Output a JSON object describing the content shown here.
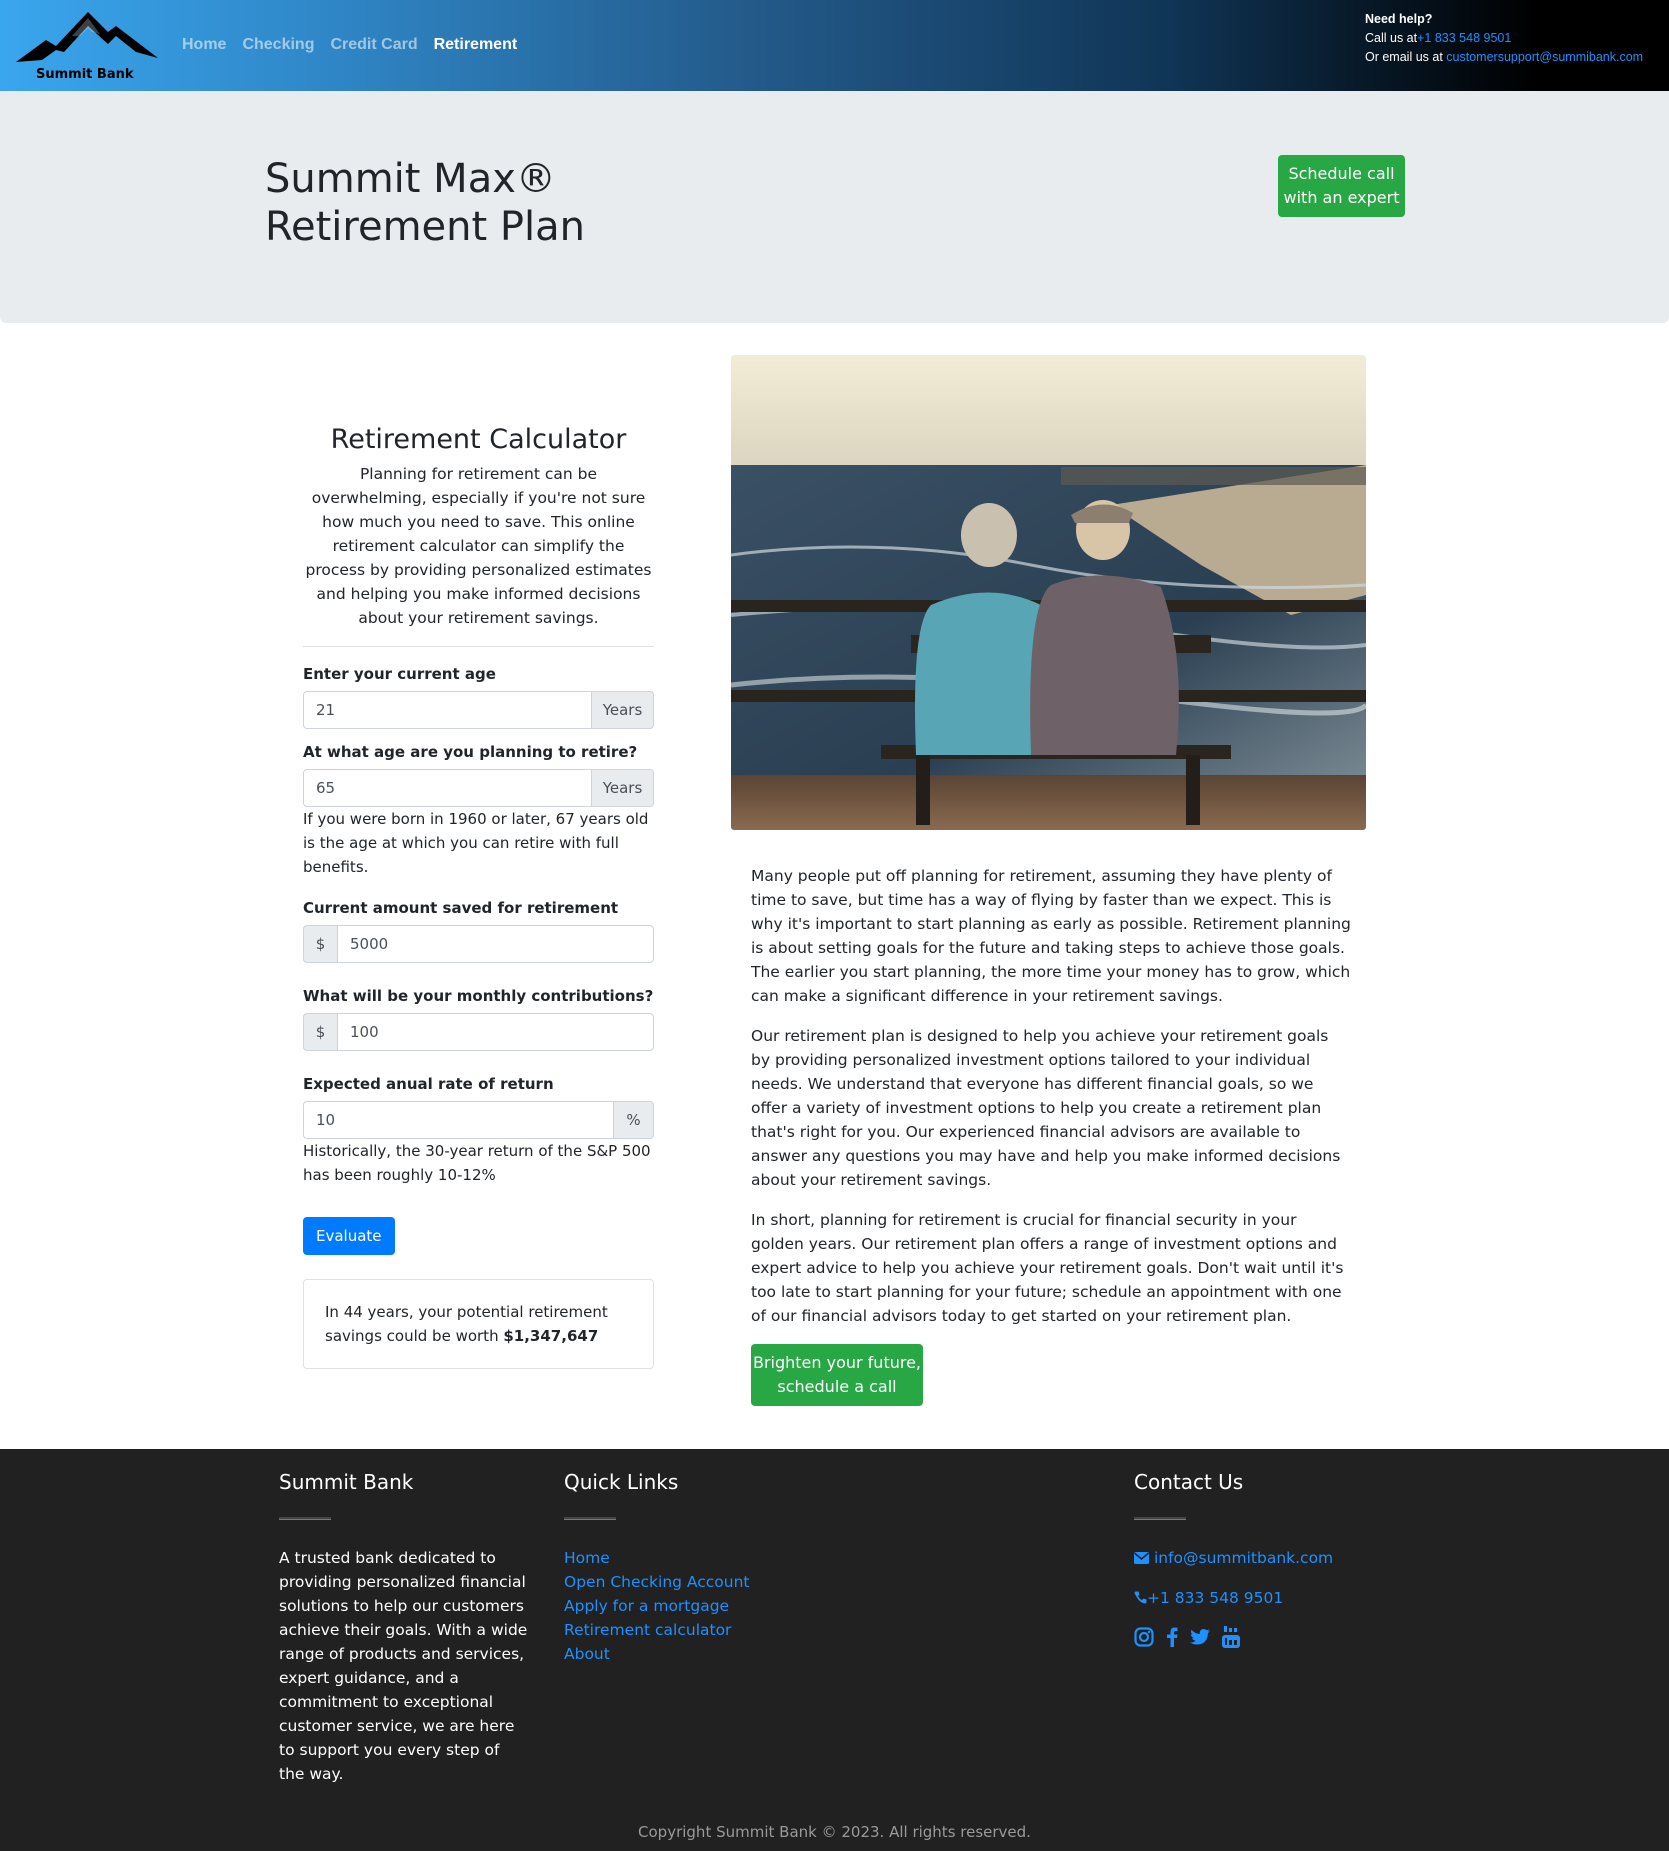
{
  "brand": {
    "name": "Summit Bank"
  },
  "nav": {
    "items": [
      {
        "label": "Home",
        "active": false
      },
      {
        "label": "Checking",
        "active": false
      },
      {
        "label": "Credit Card",
        "active": false
      },
      {
        "label": "Retirement",
        "active": true
      }
    ]
  },
  "help": {
    "title": "Need help?",
    "call_prefix": "Call us at",
    "phone": "+1 833 548 9501",
    "email_prefix": "Or email us at",
    "email": "customersupport@summibank.com"
  },
  "hero": {
    "title_line1": "Summit Max®",
    "title_line2": "Retirement Plan",
    "button_line1": "Schedule call",
    "button_line2": "with an expert"
  },
  "calculator": {
    "title": "Retirement Calculator",
    "intro": "Planning for retirement can be overwhelming, especially if you're not sure how much you need to save. This online retirement calculator can simplify the process by providing personalized estimates and helping you make informed decisions about your retirement savings.",
    "fields": {
      "current_age": {
        "label": "Enter your current age",
        "value": "21",
        "addon": "Years"
      },
      "retire_age": {
        "label": "At what age are you planning to retire?",
        "value": "65",
        "addon": "Years",
        "help": "If you were born in 1960 or later, 67 years old is the age at which you can retire with full benefits."
      },
      "current_saved": {
        "label": "Current amount saved for retirement",
        "value": "5000",
        "addon": "$"
      },
      "monthly": {
        "label": "What will be your monthly contributions?",
        "value": "100",
        "addon": "$"
      },
      "rate": {
        "label": "Expected anual rate of return",
        "value": "10",
        "addon": "%",
        "help": "Historically, the 30-year return of the S&P 500 has been roughly 10-12%"
      }
    },
    "button": "Evaluate",
    "result_prefix": "In 44 years, your potential retirement savings could be worth",
    "result_value": "$1,347,647"
  },
  "article": {
    "p1": "Many people put off planning for retirement, assuming they have plenty of time to save, but time has a way of flying by faster than we expect. This is why it's important to start planning as early as possible. Retirement planning is about setting goals for the future and taking steps to achieve those goals. The earlier you start planning, the more time your money has to grow, which can make a significant difference in your retirement savings.",
    "p2": "Our retirement plan is designed to help you achieve your retirement goals by providing personalized investment options tailored to your individual needs. We understand that everyone has different financial goals, so we offer a variety of investment options to help you create a retirement plan that's right for you. Our experienced financial advisors are available to answer any questions you may have and help you make informed decisions about your retirement savings.",
    "p3": "In short, planning for retirement is crucial for financial security in your golden years. Our retirement plan offers a range of investment options and expert advice to help you achieve your retirement goals. Don't wait until it's too late to start planning for your future; schedule an appointment with one of our financial advisors today to get started on your retirement plan.",
    "button_line1": "Brighten your future,",
    "button_line2": "schedule a call"
  },
  "footer": {
    "about": {
      "title": "Summit Bank",
      "text": "A trusted bank dedicated to providing personalized financial solutions to help our customers achieve their goals. With a wide range of products and services, expert guidance, and a commitment to exceptional customer service, we are here to support you every step of the way."
    },
    "links": {
      "title": "Quick Links",
      "items": [
        "Home",
        "Open Checking Account",
        "Apply for a mortgage",
        "Retirement calculator",
        "About"
      ]
    },
    "contact": {
      "title": "Contact Us",
      "email": "info@summitbank.com",
      "phone": "+1 833 548 9501",
      "socials": [
        "instagram-icon",
        "facebook-icon",
        "twitter-icon",
        "youtube-icon"
      ]
    },
    "copyright": "Copyright Summit Bank © 2023. All rights reserved."
  },
  "colors": {
    "accent_blue": "#007bff",
    "accent_green": "#28a745",
    "footer_bg": "#212121",
    "hero_bg": "#e9ecef"
  }
}
